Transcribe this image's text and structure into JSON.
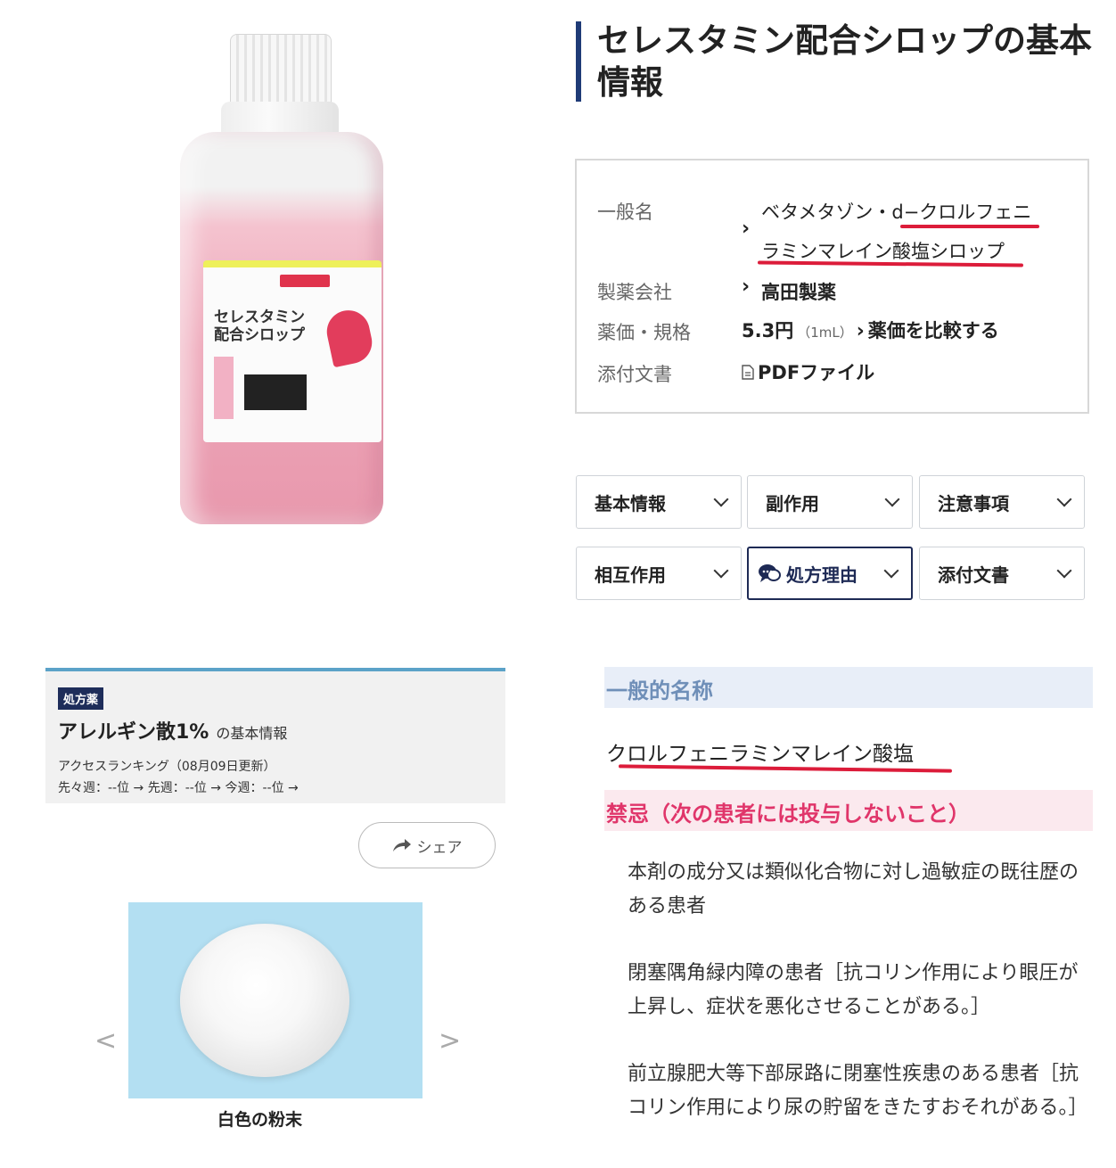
{
  "product_image": {
    "label_name": "セレスタミン配合シロップ"
  },
  "header": {
    "title": "セレスタミン配合シロップの基本情報"
  },
  "info": {
    "generic_label": "一般名",
    "generic_value_line1": "ベタメタゾン・d−クロルフェニ",
    "generic_value_line2": "ラミンマレイン酸塩シロップ",
    "maker_label": "製薬会社",
    "maker_value": "高田製薬",
    "price_label": "薬価・規格",
    "price_value": "5.3円",
    "price_unit": "（1mL）",
    "price_compare": "薬価を比較する",
    "doc_label": "添付文書",
    "doc_value": "PDFファイル"
  },
  "tabs": [
    {
      "label": "基本情報"
    },
    {
      "label": "副作用"
    },
    {
      "label": "注意事項"
    },
    {
      "label": "相互作用"
    },
    {
      "label": "処方理由"
    },
    {
      "label": "添付文書"
    }
  ],
  "card": {
    "badge": "処方薬",
    "title": "アレルギン散1%",
    "title_suffix": "の基本情報",
    "ranking": "アクセスランキング（08月09日更新）",
    "rank_line": "先々週：--位 →  先週：--位 →  今週：--位 →"
  },
  "share": {
    "label": "シェア"
  },
  "powder": {
    "caption": "白色の粉末",
    "prev": "<",
    "next": ">"
  },
  "section": {
    "generic_heading": "一般的名称",
    "generic_name": "クロルフェニラミンマレイン酸塩",
    "contra_heading": "禁忌（次の患者には投与しないこと）",
    "items": [
      "本剤の成分又は類似化合物に対し過敏症の既往歴のある患者",
      "閉塞隅角緑内障の患者［抗コリン作用により眼圧が上昇し、症状を悪化させることがある。］",
      "前立腺肥大等下部尿路に閉塞性疾患のある患者［抗コリン作用により尿の貯留をきたすおそれがある。］"
    ]
  },
  "colors": {
    "accent_navy": "#1f3b77",
    "underline_red": "#dc1c3a",
    "warn_pink": "#e0356a"
  }
}
